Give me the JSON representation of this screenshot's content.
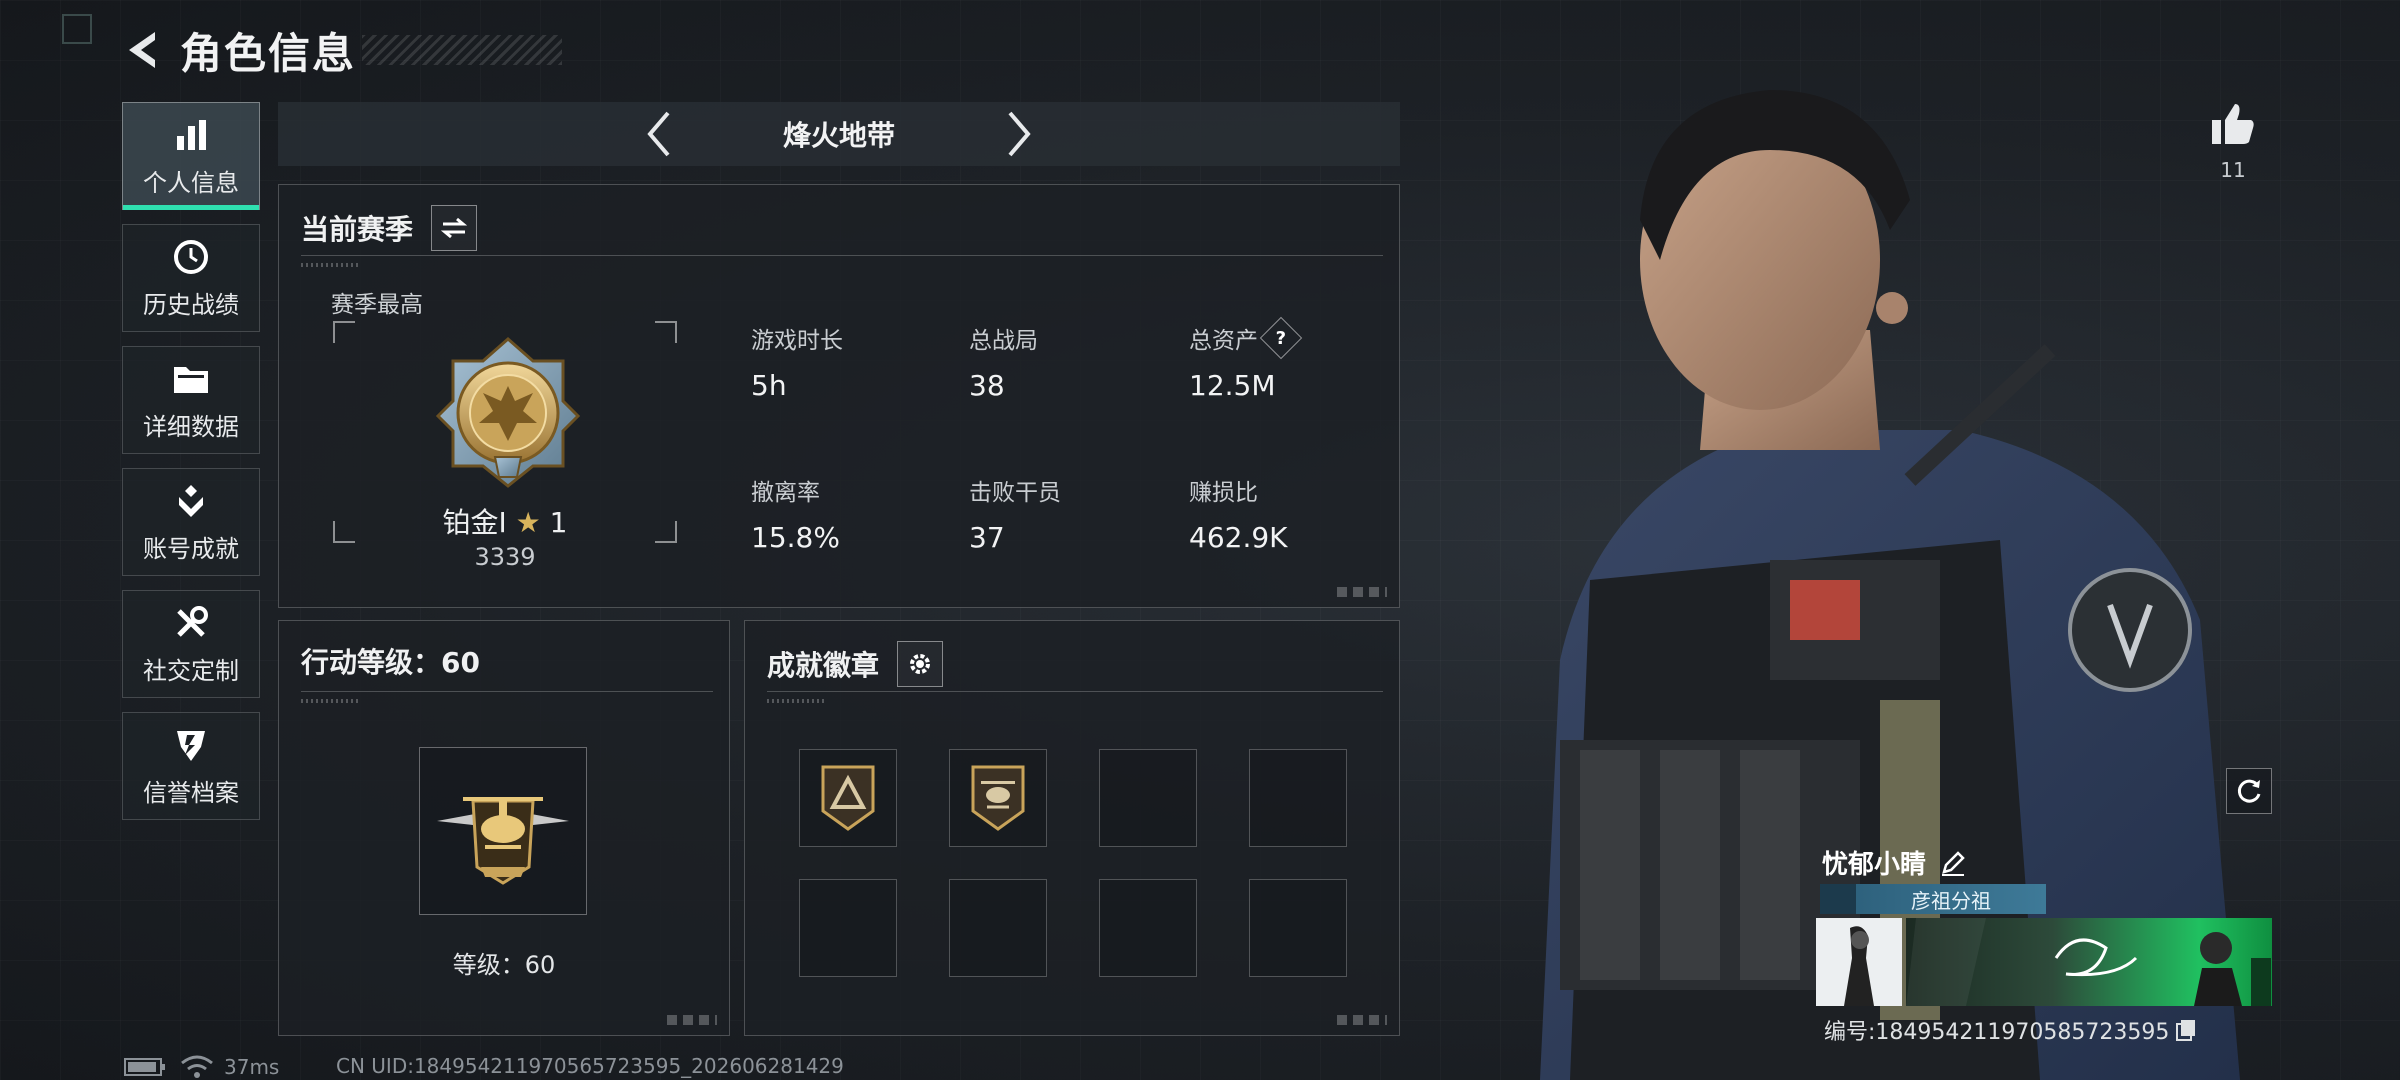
{
  "header": {
    "title": "角色信息"
  },
  "sidebar": {
    "items": [
      {
        "label": "个人信息",
        "icon": "bar-chart-icon"
      },
      {
        "label": "历史战绩",
        "icon": "history-clock-icon"
      },
      {
        "label": "详细数据",
        "icon": "folder-icon"
      },
      {
        "label": "账号成就",
        "icon": "achievement-icon"
      },
      {
        "label": "社交定制",
        "icon": "tools-icon"
      },
      {
        "label": "信誉档案",
        "icon": "shield-badge-icon"
      }
    ]
  },
  "mode": {
    "name": "烽火地带"
  },
  "season": {
    "title": "当前赛季",
    "best_label": "赛季最高",
    "rank_name": "铂金I",
    "rank_stars": "1",
    "rank_score": "3339",
    "stats": [
      {
        "label": "游戏时长",
        "value": "5h"
      },
      {
        "label": "总战局",
        "value": "38"
      },
      {
        "label": "总资产",
        "value": "12.5M",
        "has_help": true
      },
      {
        "label": "撤离率",
        "value": "15.8%"
      },
      {
        "label": "击败干员",
        "value": "37"
      },
      {
        "label": "赚损比",
        "value": "462.9K"
      }
    ]
  },
  "level_panel": {
    "title": "行动等级：60",
    "level_text": "等级：60"
  },
  "achievements": {
    "title": "成就徽章",
    "slots": 8,
    "filled": 2
  },
  "likes": {
    "count": "11"
  },
  "player": {
    "name": "忧郁小睛",
    "clan": "彦祖分祖",
    "id_text": "编号:18495421197058572359​5"
  },
  "status": {
    "ping": "37ms",
    "uid": "CN UID:18495421197056572359​5_202606281429"
  },
  "colors": {
    "accent": "#2fe0b0",
    "gold": "#c9a45a"
  }
}
